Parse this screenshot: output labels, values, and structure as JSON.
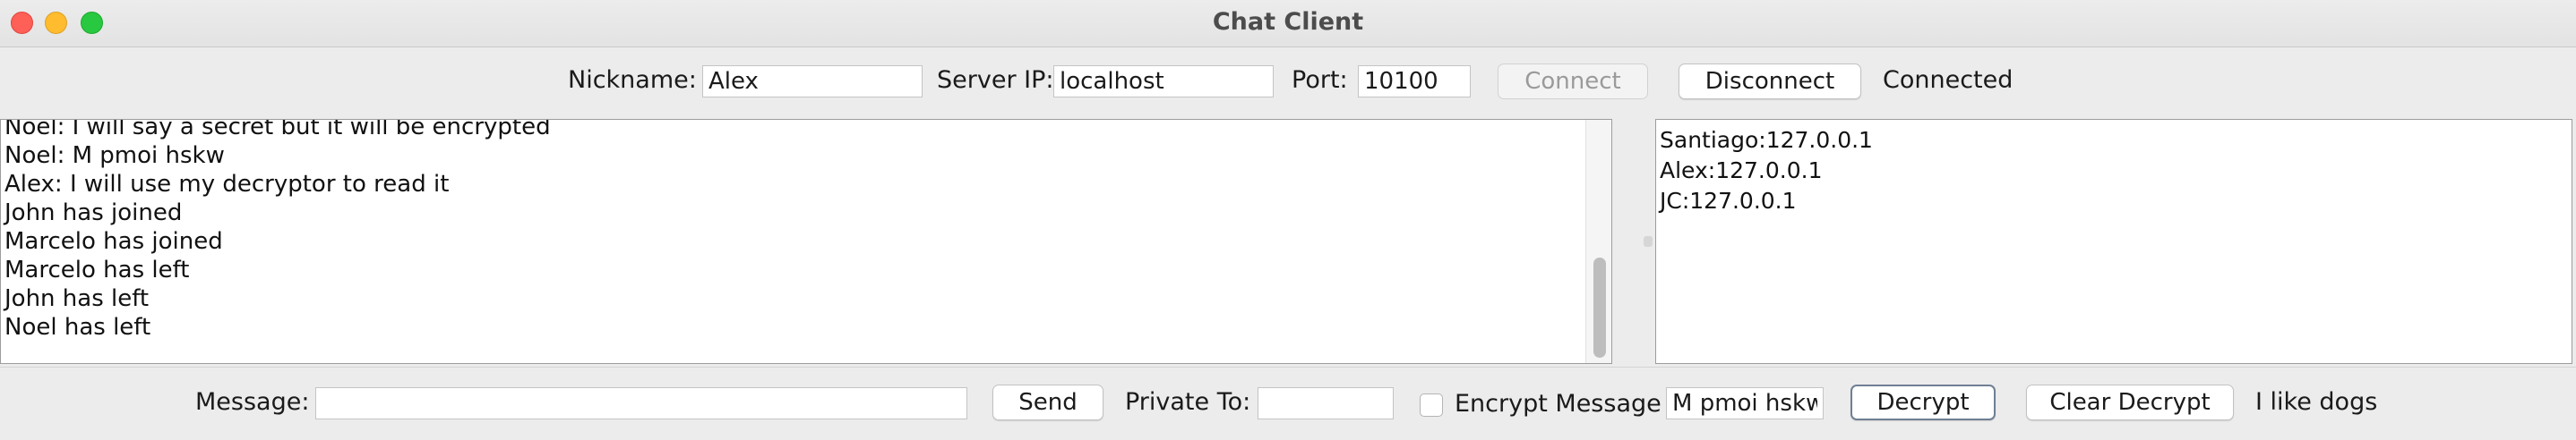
{
  "window": {
    "title": "Chat Client"
  },
  "connection": {
    "nickname_label": "Nickname:",
    "nickname_value": "Alex",
    "server_ip_label": "Server IP:",
    "server_ip_value": "localhost",
    "port_label": "Port:",
    "port_value": "10100",
    "connect_label": "Connect",
    "disconnect_label": "Disconnect",
    "status": "Connected"
  },
  "chat": {
    "messages": [
      "Noel: I will say a secret but it will be encrypted",
      "Noel: M pmoi hskw",
      "Alex: I will use my decryptor to read it",
      "John has joined",
      "Marcelo has joined",
      "Marcelo has left",
      "John has left",
      "Noel has left"
    ]
  },
  "users": [
    "Santiago:127.0.0.1",
    "Alex:127.0.0.1",
    "JC:127.0.0.1"
  ],
  "composer": {
    "message_label": "Message:",
    "message_value": "",
    "send_label": "Send",
    "private_to_label": "Private To:",
    "private_to_value": "",
    "encrypt_label": "Encrypt Message",
    "encrypt_checked": false,
    "decrypt_input_value": "M pmoi hskw",
    "decrypt_label": "Decrypt",
    "clear_decrypt_label": "Clear Decrypt",
    "decrypted_text": "I like dogs"
  },
  "colors": {
    "close": "#fe5f57",
    "minimize": "#febc2e",
    "maximize": "#28c840",
    "window_bg": "#ececec"
  }
}
